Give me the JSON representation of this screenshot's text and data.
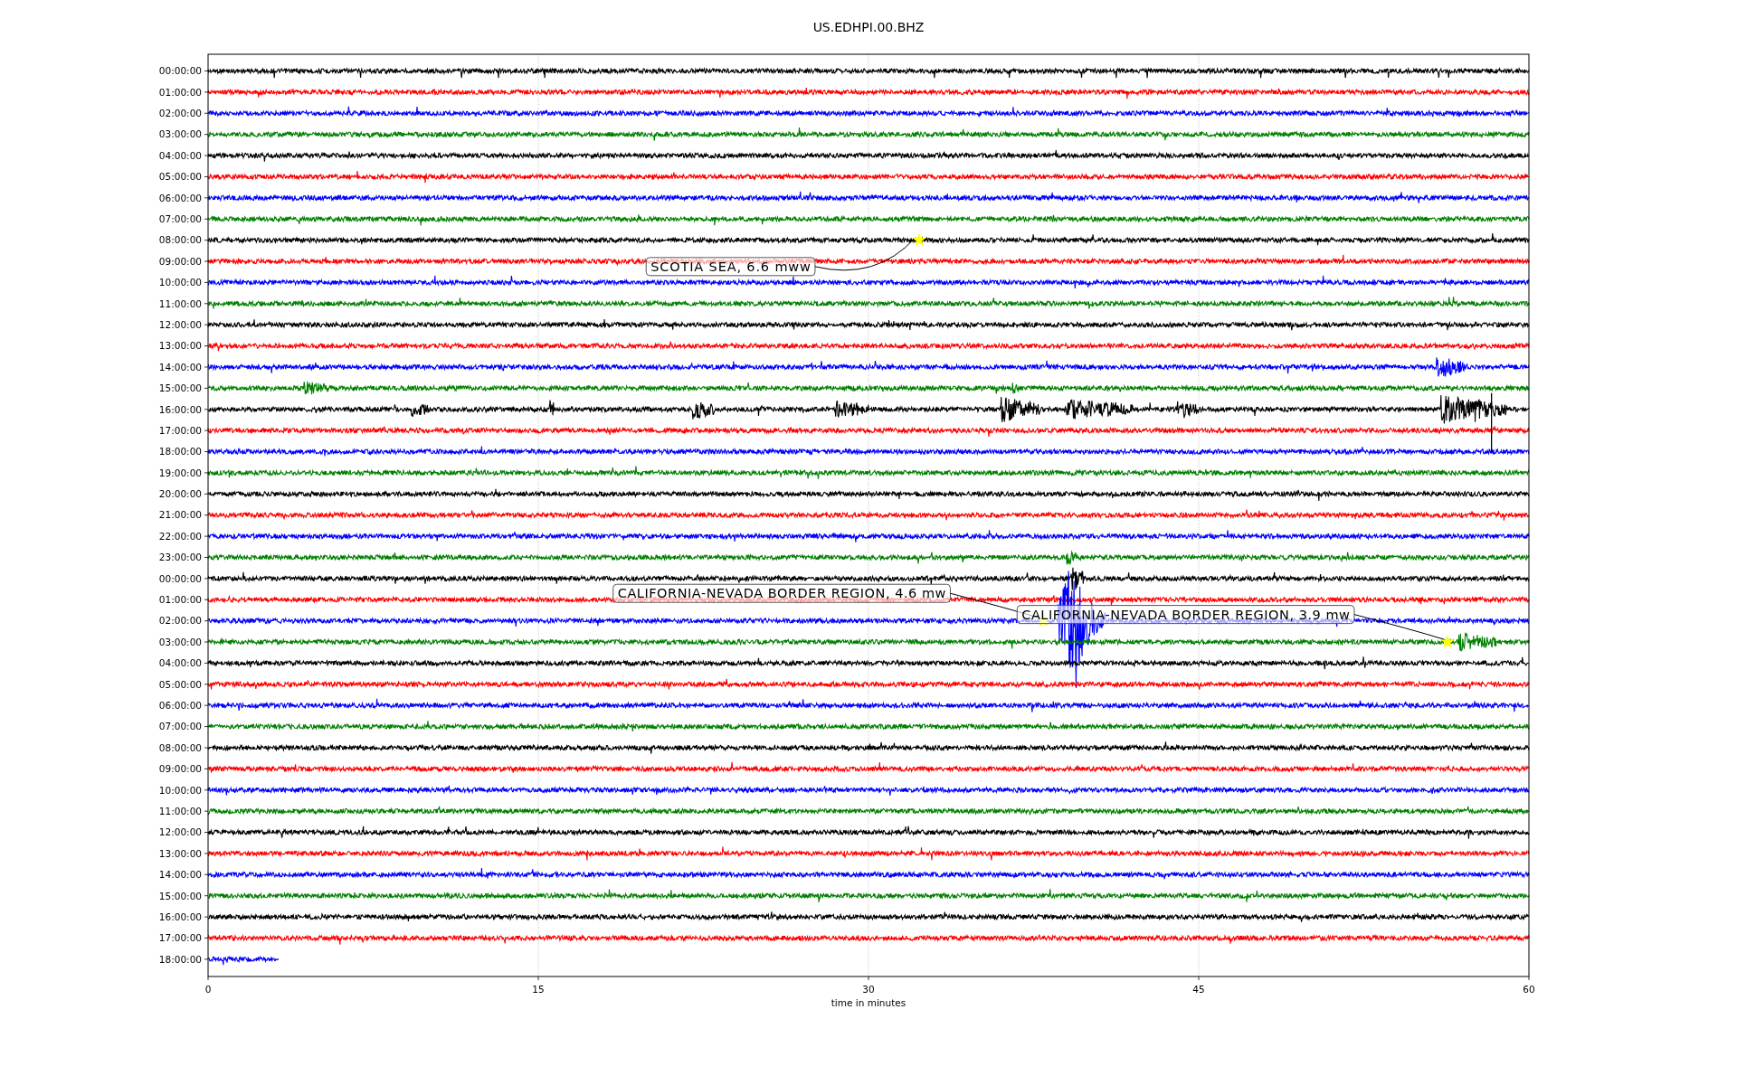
{
  "title": "US.EDHPI.00.BHZ",
  "rows": [
    {
      "label": "00:00:00",
      "color": "#000000"
    },
    {
      "label": "01:00:00",
      "color": "#ff0000"
    },
    {
      "label": "02:00:00",
      "color": "#0000ff"
    },
    {
      "label": "03:00:00",
      "color": "#008000"
    },
    {
      "label": "04:00:00",
      "color": "#000000"
    },
    {
      "label": "05:00:00",
      "color": "#ff0000"
    },
    {
      "label": "06:00:00",
      "color": "#0000ff"
    },
    {
      "label": "07:00:00",
      "color": "#008000"
    },
    {
      "label": "08:00:00",
      "color": "#000000"
    },
    {
      "label": "09:00:00",
      "color": "#ff0000"
    },
    {
      "label": "10:00:00",
      "color": "#0000ff"
    },
    {
      "label": "11:00:00",
      "color": "#008000"
    },
    {
      "label": "12:00:00",
      "color": "#000000"
    },
    {
      "label": "13:00:00",
      "color": "#ff0000"
    },
    {
      "label": "14:00:00",
      "color": "#0000ff"
    },
    {
      "label": "15:00:00",
      "color": "#008000"
    },
    {
      "label": "16:00:00",
      "color": "#000000"
    },
    {
      "label": "17:00:00",
      "color": "#ff0000"
    },
    {
      "label": "18:00:00",
      "color": "#0000ff"
    },
    {
      "label": "19:00:00",
      "color": "#008000"
    },
    {
      "label": "20:00:00",
      "color": "#000000"
    },
    {
      "label": "21:00:00",
      "color": "#ff0000"
    },
    {
      "label": "22:00:00",
      "color": "#0000ff"
    },
    {
      "label": "23:00:00",
      "color": "#008000"
    },
    {
      "label": "00:00:00",
      "color": "#000000"
    },
    {
      "label": "01:00:00",
      "color": "#ff0000"
    },
    {
      "label": "02:00:00",
      "color": "#0000ff"
    },
    {
      "label": "03:00:00",
      "color": "#008000"
    },
    {
      "label": "04:00:00",
      "color": "#000000"
    },
    {
      "label": "05:00:00",
      "color": "#ff0000"
    },
    {
      "label": "06:00:00",
      "color": "#0000ff"
    },
    {
      "label": "07:00:00",
      "color": "#008000"
    },
    {
      "label": "08:00:00",
      "color": "#000000"
    },
    {
      "label": "09:00:00",
      "color": "#ff0000"
    },
    {
      "label": "10:00:00",
      "color": "#0000ff"
    },
    {
      "label": "11:00:00",
      "color": "#008000"
    },
    {
      "label": "12:00:00",
      "color": "#000000"
    },
    {
      "label": "13:00:00",
      "color": "#ff0000"
    },
    {
      "label": "14:00:00",
      "color": "#0000ff"
    },
    {
      "label": "15:00:00",
      "color": "#008000"
    },
    {
      "label": "16:00:00",
      "color": "#000000"
    },
    {
      "label": "17:00:00",
      "color": "#ff0000"
    },
    {
      "label": "18:00:00",
      "color": "#0000ff"
    }
  ],
  "xticks": [
    "0",
    "15",
    "30",
    "45",
    "60"
  ],
  "xlabel": "time in minutes",
  "annotations": [
    {
      "text": "SCOTIA SEA, 6.6 mww"
    },
    {
      "text": "CALIFORNIA-NEVADA BORDER REGION, 4.6 mw"
    },
    {
      "text": "CALIFORNIA-NEVADA BORDER REGION, 3.9 mw"
    }
  ]
}
